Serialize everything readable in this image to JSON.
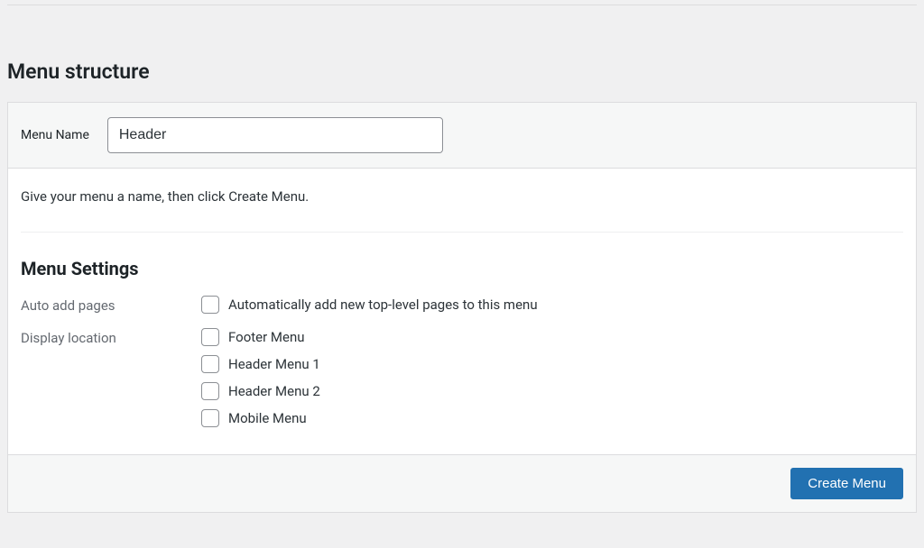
{
  "page": {
    "title": "Menu structure"
  },
  "menu_name": {
    "label": "Menu Name",
    "value": "Header"
  },
  "instruction": "Give your menu a name, then click Create Menu.",
  "settings": {
    "heading": "Menu Settings",
    "auto_add": {
      "label": "Auto add pages",
      "option": "Automatically add new top-level pages to this menu"
    },
    "display_location": {
      "label": "Display location",
      "options": [
        "Footer Menu",
        "Header Menu 1",
        "Header Menu 2",
        "Mobile Menu"
      ]
    }
  },
  "footer": {
    "create_button": "Create Menu"
  }
}
